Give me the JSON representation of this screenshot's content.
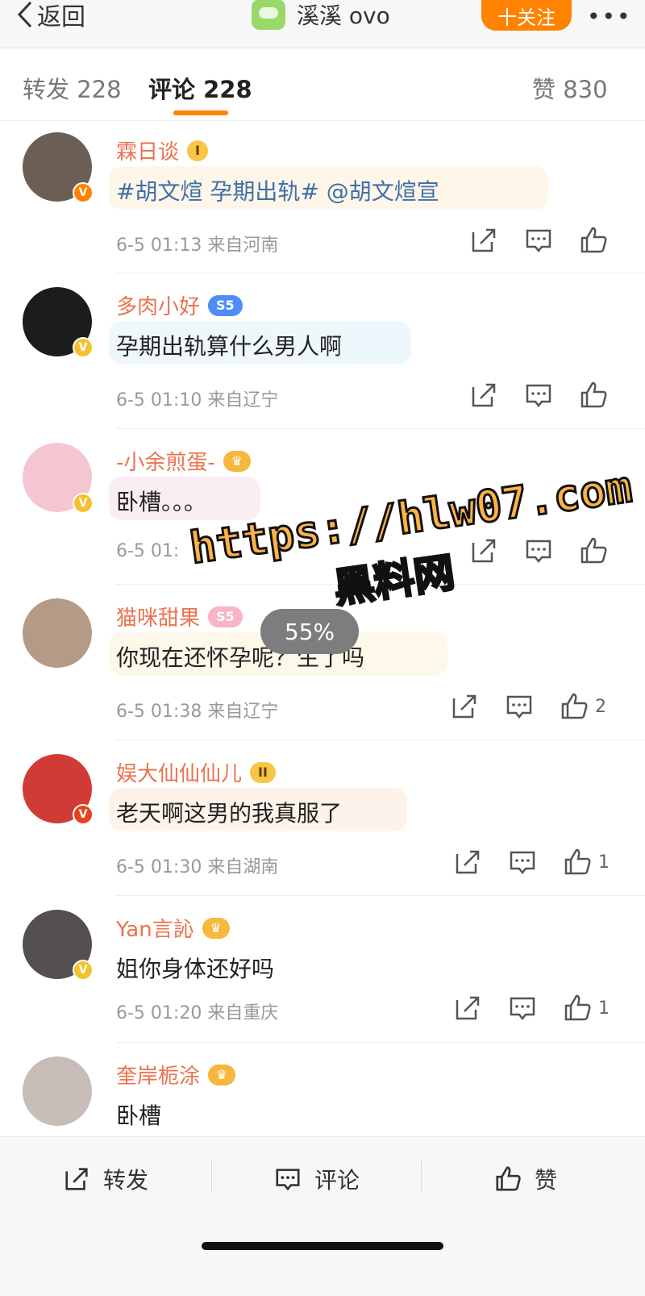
{
  "nav": {
    "back_label": "返回",
    "title": "溪溪 ovo",
    "follow_label": "十关注",
    "more_label": "•••"
  },
  "tabs": {
    "repost": "转发 228",
    "comment": "评论 228",
    "like": "赞 830"
  },
  "comments": [
    {
      "user": "霖日谈",
      "badge": "I",
      "text": "#胡文煊 孕期出轨# @胡文煊宣",
      "time": "6-5 01:13 来自河南",
      "likes": ""
    },
    {
      "user": "多肉小好",
      "badge": "S5",
      "text": "孕期出轨算什么男人啊",
      "time": "6-5 01:10 来自辽宁",
      "likes": ""
    },
    {
      "user": "-小余煎蛋-",
      "badge": "",
      "text": "卧槽。。。",
      "time": "6-5 01:",
      "likes": ""
    },
    {
      "user": "猫咪甜果",
      "badge": "S5",
      "text": "你现在还怀孕呢？生了吗",
      "time": "6-5 01:38 来自辽宁",
      "likes": "2"
    },
    {
      "user": "娱大仙仙仙儿",
      "badge": "II",
      "text": "老天啊这男的我真服了",
      "time": "6-5 01:30 来自湖南",
      "likes": "1"
    },
    {
      "user": "Yan言訫",
      "badge": "",
      "text": "姐你身体还好吗",
      "time": "6-5 01:20 来自重庆",
      "likes": "1"
    },
    {
      "user": "奎岸栀涂",
      "badge": "",
      "text": "卧槽",
      "time": "",
      "likes": ""
    }
  ],
  "watermark": {
    "line1": "https://hlw07.com",
    "line2": "黑料网"
  },
  "progress_label": "55%",
  "bottom": {
    "repost": "转发",
    "comment": "评论",
    "like": "赞"
  }
}
